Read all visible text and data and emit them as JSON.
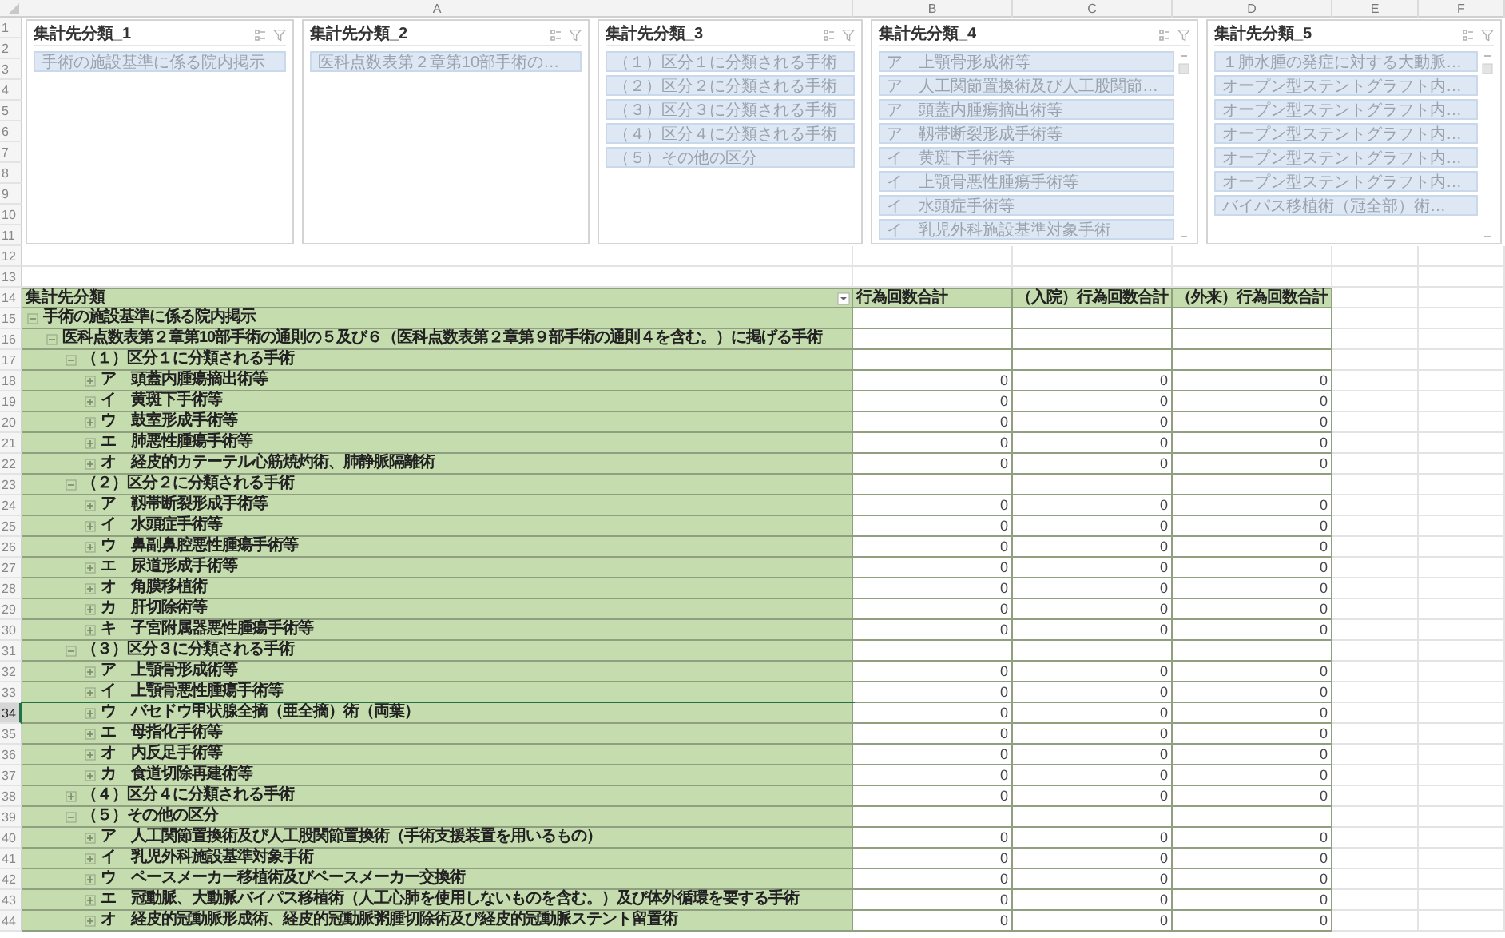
{
  "column_headers": [
    "A",
    "B",
    "C",
    "D",
    "E",
    "F"
  ],
  "row_headers": [
    {
      "label": "1",
      "selected": false
    },
    {
      "label": "2",
      "selected": false
    },
    {
      "label": "3",
      "selected": false
    },
    {
      "label": "4",
      "selected": false
    },
    {
      "label": "5",
      "selected": false
    },
    {
      "label": "6",
      "selected": false
    },
    {
      "label": "7",
      "selected": false
    },
    {
      "label": "8",
      "selected": false
    },
    {
      "label": "9",
      "selected": false
    },
    {
      "label": "10",
      "selected": false
    },
    {
      "label": "11",
      "selected": false
    },
    {
      "label": "12",
      "selected": false
    },
    {
      "label": "13",
      "selected": false
    },
    {
      "label": "14",
      "selected": false
    },
    {
      "label": "15",
      "selected": false
    },
    {
      "label": "16",
      "selected": false
    },
    {
      "label": "17",
      "selected": false
    },
    {
      "label": "18",
      "selected": false
    },
    {
      "label": "19",
      "selected": false
    },
    {
      "label": "20",
      "selected": false
    },
    {
      "label": "21",
      "selected": false
    },
    {
      "label": "22",
      "selected": false
    },
    {
      "label": "23",
      "selected": false
    },
    {
      "label": "24",
      "selected": false
    },
    {
      "label": "25",
      "selected": false
    },
    {
      "label": "26",
      "selected": false
    },
    {
      "label": "27",
      "selected": false
    },
    {
      "label": "28",
      "selected": false
    },
    {
      "label": "29",
      "selected": false
    },
    {
      "label": "30",
      "selected": false
    },
    {
      "label": "31",
      "selected": false
    },
    {
      "label": "32",
      "selected": false
    },
    {
      "label": "33",
      "selected": false
    },
    {
      "label": "34",
      "selected": true
    },
    {
      "label": "35",
      "selected": false
    },
    {
      "label": "36",
      "selected": false
    },
    {
      "label": "37",
      "selected": false
    },
    {
      "label": "38",
      "selected": false
    },
    {
      "label": "39",
      "selected": false
    },
    {
      "label": "40",
      "selected": false
    },
    {
      "label": "41",
      "selected": false
    },
    {
      "label": "42",
      "selected": false
    },
    {
      "label": "43",
      "selected": false
    },
    {
      "label": "44",
      "selected": false
    }
  ],
  "slicers": [
    {
      "title": "集計先分類_1",
      "scrollable": false,
      "items": [
        {
          "label": "手術の施設基準に係る院内掲示",
          "selected": true
        }
      ]
    },
    {
      "title": "集計先分類_2",
      "scrollable": false,
      "items": [
        {
          "label": "医科点数表第２章第10部手術の…",
          "selected": true
        }
      ]
    },
    {
      "title": "集計先分類_3",
      "scrollable": false,
      "items": [
        {
          "label": "（１）区分１に分類される手術",
          "selected": true
        },
        {
          "label": "（２）区分２に分類される手術",
          "selected": true
        },
        {
          "label": "（３）区分３に分類される手術",
          "selected": true
        },
        {
          "label": "（４）区分４に分類される手術",
          "selected": true
        },
        {
          "label": "（５）その他の区分",
          "selected": true
        }
      ]
    },
    {
      "title": "集計先分類_4",
      "scrollable": true,
      "items": [
        {
          "label": "ア　上顎骨形成術等",
          "selected": true
        },
        {
          "label": "ア　人工関節置換術及び人工股関節…",
          "selected": true
        },
        {
          "label": "ア　頭蓋内腫瘍摘出術等",
          "selected": true
        },
        {
          "label": "ア　靱帯断裂形成手術等",
          "selected": true
        },
        {
          "label": "イ　黄斑下手術等",
          "selected": true
        },
        {
          "label": "イ　上顎骨悪性腫瘍手術等",
          "selected": true
        },
        {
          "label": "イ　水頭症手術等",
          "selected": true
        },
        {
          "label": "イ　乳児外科施設基準対象手術",
          "selected": true
        }
      ]
    },
    {
      "title": "集計先分類_5",
      "scrollable": true,
      "items": [
        {
          "label": "１肺水腫の発症に対する大動脈…",
          "selected": true
        },
        {
          "label": "オープン型ステントグラフト内…",
          "selected": true
        },
        {
          "label": "オープン型ステントグラフト内…",
          "selected": true
        },
        {
          "label": "オープン型ステントグラフト内…",
          "selected": true
        },
        {
          "label": "オープン型ステントグラフト内…",
          "selected": true
        },
        {
          "label": "オープン型ステントグラフト内…",
          "selected": true
        },
        {
          "label": "バイパス移植術（冠全部）術…",
          "selected": true
        }
      ]
    }
  ],
  "pivot": {
    "header": "集計先分類",
    "columns": [
      "行為回数合計",
      "（入院）行為回数合計",
      "（外来）行為回数合計"
    ],
    "rows": [
      {
        "label": "手術の施設基準に係る院内掲示",
        "expanded": true,
        "children": [
          {
            "label": "医科点数表第２章第10部手術の通則の５及び６（医科点数表第２章第９部手術の通則４を含む。）に掲げる手術",
            "expanded": true,
            "children": [
              {
                "label": "（１）区分１に分類される手術",
                "expanded": true,
                "children": [
                  {
                    "label": "ア　頭蓋内腫瘍摘出術等",
                    "expanded": false,
                    "values": [
                      "0",
                      "0",
                      "0"
                    ]
                  },
                  {
                    "label": "イ　黄斑下手術等",
                    "expanded": false,
                    "values": [
                      "0",
                      "0",
                      "0"
                    ]
                  },
                  {
                    "label": "ウ　鼓室形成手術等",
                    "expanded": false,
                    "values": [
                      "0",
                      "0",
                      "0"
                    ]
                  },
                  {
                    "label": "エ　肺悪性腫瘍手術等",
                    "expanded": false,
                    "values": [
                      "0",
                      "0",
                      "0"
                    ]
                  },
                  {
                    "label": "オ　経皮的カテーテル心筋焼灼術、肺静脈隔離術",
                    "expanded": false,
                    "values": [
                      "0",
                      "0",
                      "0"
                    ]
                  }
                ]
              },
              {
                "label": "（２）区分２に分類される手術",
                "expanded": true,
                "children": [
                  {
                    "label": "ア　靱帯断裂形成手術等",
                    "expanded": false,
                    "values": [
                      "0",
                      "0",
                      "0"
                    ]
                  },
                  {
                    "label": "イ　水頭症手術等",
                    "expanded": false,
                    "values": [
                      "0",
                      "0",
                      "0"
                    ]
                  },
                  {
                    "label": "ウ　鼻副鼻腔悪性腫瘍手術等",
                    "expanded": false,
                    "values": [
                      "0",
                      "0",
                      "0"
                    ]
                  },
                  {
                    "label": "エ　尿道形成手術等",
                    "expanded": false,
                    "values": [
                      "0",
                      "0",
                      "0"
                    ]
                  },
                  {
                    "label": "オ　角膜移植術",
                    "expanded": false,
                    "values": [
                      "0",
                      "0",
                      "0"
                    ]
                  },
                  {
                    "label": "カ　肝切除術等",
                    "expanded": false,
                    "values": [
                      "0",
                      "0",
                      "0"
                    ]
                  },
                  {
                    "label": "キ　子宮附属器悪性腫瘍手術等",
                    "expanded": false,
                    "values": [
                      "0",
                      "0",
                      "0"
                    ]
                  }
                ]
              },
              {
                "label": "（３）区分３に分類される手術",
                "expanded": true,
                "children": [
                  {
                    "label": "ア　上顎骨形成術等",
                    "expanded": false,
                    "values": [
                      "0",
                      "0",
                      "0"
                    ]
                  },
                  {
                    "label": "イ　上顎骨悪性腫瘍手術等",
                    "expanded": false,
                    "values": [
                      "0",
                      "0",
                      "0"
                    ]
                  },
                  {
                    "label": "ウ　バセドウ甲状腺全摘（亜全摘）術（両葉）",
                    "expanded": false,
                    "values": [
                      "0",
                      "0",
                      "0"
                    ]
                  },
                  {
                    "label": "エ　母指化手術等",
                    "expanded": false,
                    "values": [
                      "0",
                      "0",
                      "0"
                    ]
                  },
                  {
                    "label": "オ　内反足手術等",
                    "expanded": false,
                    "values": [
                      "0",
                      "0",
                      "0"
                    ]
                  },
                  {
                    "label": "カ　食道切除再建術等",
                    "expanded": false,
                    "values": [
                      "0",
                      "0",
                      "0"
                    ]
                  }
                ]
              },
              {
                "label": "（４）区分４に分類される手術",
                "expanded": false,
                "values": [
                  "0",
                  "0",
                  "0"
                ]
              },
              {
                "label": "（５）その他の区分",
                "expanded": true,
                "children": [
                  {
                    "label": "ア　人工関節置換術及び人工股関節置換術（手術支援装置を用いるもの）",
                    "expanded": false,
                    "values": [
                      "0",
                      "0",
                      "0"
                    ]
                  },
                  {
                    "label": "イ　乳児外科施設基準対象手術",
                    "expanded": false,
                    "values": [
                      "0",
                      "0",
                      "0"
                    ]
                  },
                  {
                    "label": "ウ　ペースメーカー移植術及びペースメーカー交換術",
                    "expanded": false,
                    "values": [
                      "0",
                      "0",
                      "0"
                    ]
                  },
                  {
                    "label": "エ　冠動脈、大動脈バイパス移植術（人工心肺を使用しないものを含む。）及び体外循環を要する手術",
                    "expanded": false,
                    "values": [
                      "0",
                      "0",
                      "0"
                    ]
                  },
                  {
                    "label": "オ　経皮的冠動脈形成術、経皮的冠動脈粥腫切除術及び経皮的冠動脈ステント留置術",
                    "expanded": false,
                    "values": [
                      "0",
                      "0",
                      "0"
                    ]
                  }
                ]
              }
            ]
          }
        ]
      }
    ]
  }
}
